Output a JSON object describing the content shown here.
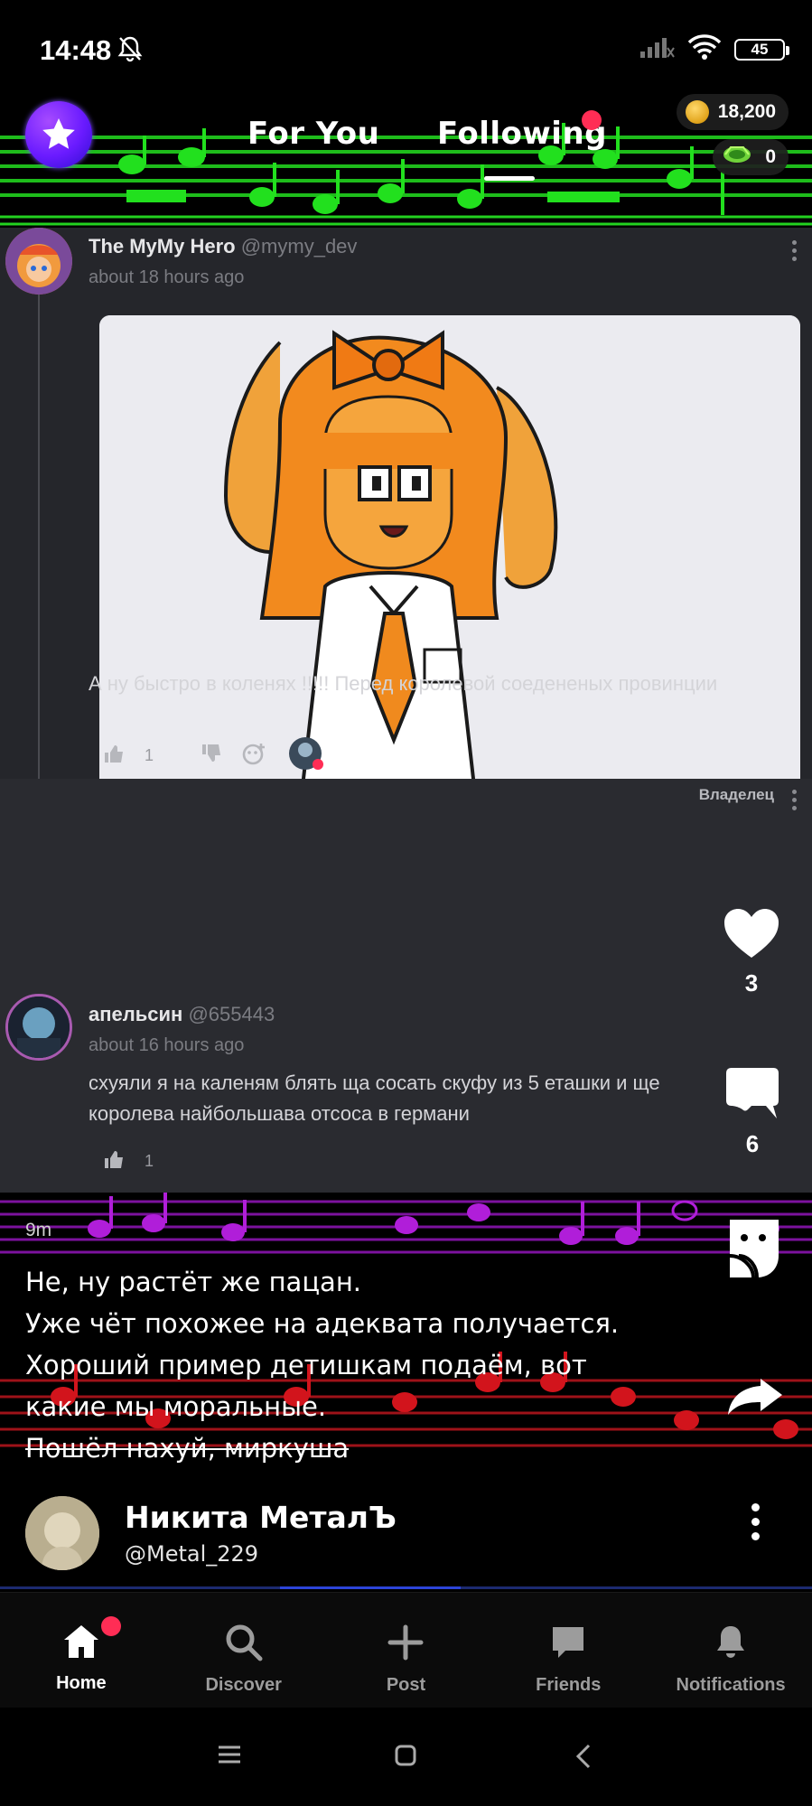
{
  "status_bar": {
    "time": "14:48",
    "battery": "45",
    "icons": [
      "bell-muted-icon",
      "signal-icon",
      "wifi-icon",
      "battery-icon"
    ]
  },
  "header": {
    "tabs": [
      {
        "label": "For You",
        "active": false
      },
      {
        "label": "Following",
        "active": true,
        "has_dot": true
      }
    ],
    "coins": "18,200",
    "gems": "0"
  },
  "embedded_post": {
    "author": "The MyMy Hero",
    "handle": "@mymy_dev",
    "time": "about 18 hours ago",
    "text": "А ну быстро в коленях !!!!! Перед королевой соедененых провинции",
    "like_count": "1"
  },
  "embedded_reply": {
    "author": "апельсин",
    "handle": "@655443",
    "badge": "Владелец",
    "time": "about 16 hours ago",
    "text_line1": "схуяли я на каленям блять ща сосать скуфу из 5 еташки и ще",
    "text_line2": "королева найбольшава отсоса в германи",
    "like_count": "1"
  },
  "side_actions": {
    "likes": "3",
    "comments": "6"
  },
  "caption": {
    "time": "9m",
    "lines": [
      "Не, ну растёт же пацан.",
      "Уже чёт похожее на адеквата получается.",
      "Хороший пример детишкам подаём, вот",
      "какие мы моральные."
    ],
    "struck_line": "Пошёл нахуй, миркуша"
  },
  "author": {
    "name": "Никита МеталЪ",
    "handle": "@Metal_229"
  },
  "bottom_nav": [
    {
      "label": "Home",
      "icon": "home-icon",
      "active": true
    },
    {
      "label": "Discover",
      "icon": "search-icon",
      "active": false
    },
    {
      "label": "Post",
      "icon": "plus-icon",
      "active": false
    },
    {
      "label": "Friends",
      "icon": "chat-icon",
      "active": false
    },
    {
      "label": "Notifications",
      "icon": "bell-icon",
      "active": false
    }
  ],
  "colors": {
    "accent_red": "#ff2d55",
    "staff_green": "#22d11f",
    "staff_purple": "#b01ed9",
    "staff_red": "#d2141c",
    "embed_bg": "#25262b"
  }
}
